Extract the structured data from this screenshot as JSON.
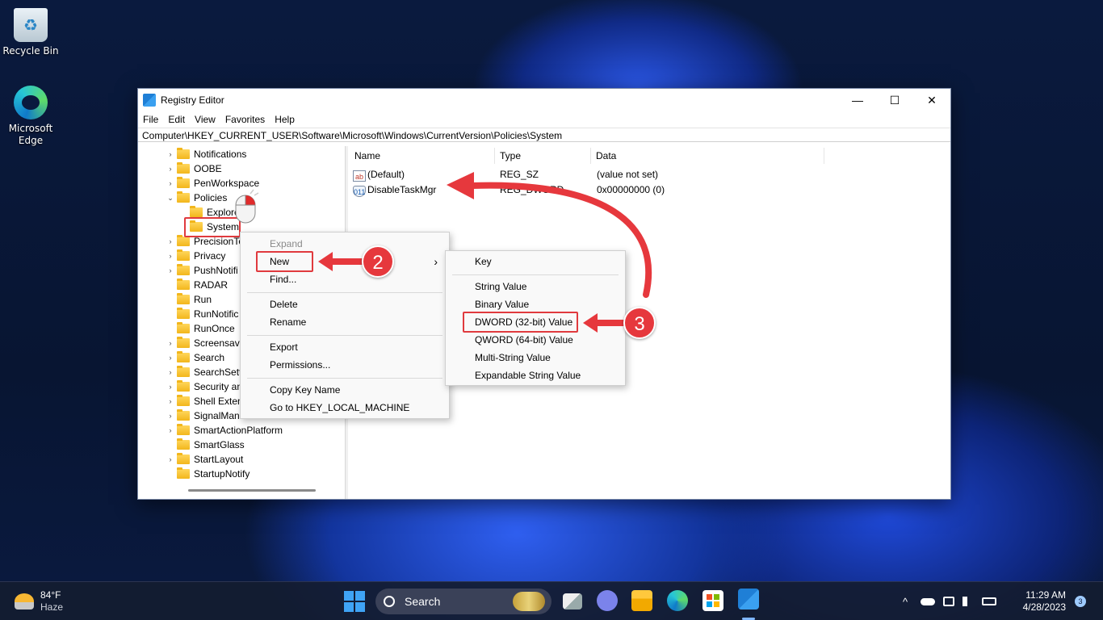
{
  "desktop": {
    "icons": [
      {
        "label": "Recycle Bin",
        "icon": "recycle-bin-icon"
      },
      {
        "label": "Microsoft Edge",
        "icon": "edge-icon"
      }
    ]
  },
  "window": {
    "title": "Registry Editor",
    "controls": {
      "minimize": "—",
      "maximize": "☐",
      "close": "✕"
    },
    "menu": [
      "File",
      "Edit",
      "View",
      "Favorites",
      "Help"
    ],
    "address": "Computer\\HKEY_CURRENT_USER\\Software\\Microsoft\\Windows\\CurrentVersion\\Policies\\System"
  },
  "tree": {
    "items": [
      {
        "label": "Notifications",
        "expander": "›"
      },
      {
        "label": "OOBE",
        "expander": "›"
      },
      {
        "label": "PenWorkspace",
        "expander": "›"
      },
      {
        "label": "Policies",
        "expander": "⌄"
      },
      {
        "label": "Explorer",
        "expander": ""
      },
      {
        "label": "System",
        "expander": ""
      },
      {
        "label": "PrecisionTo",
        "expander": "›"
      },
      {
        "label": "Privacy",
        "expander": "›"
      },
      {
        "label": "PushNotifi",
        "expander": "›"
      },
      {
        "label": "RADAR",
        "expander": ""
      },
      {
        "label": "Run",
        "expander": ""
      },
      {
        "label": "RunNotific",
        "expander": ""
      },
      {
        "label": "RunOnce",
        "expander": ""
      },
      {
        "label": "Screensave",
        "expander": "›"
      },
      {
        "label": "Search",
        "expander": "›"
      },
      {
        "label": "SearchSetti",
        "expander": "›"
      },
      {
        "label": "Security an",
        "expander": "›"
      },
      {
        "label": "Shell Exten",
        "expander": "›"
      },
      {
        "label": "SignalMana",
        "expander": "›"
      },
      {
        "label": "SmartActionPlatform",
        "expander": "›"
      },
      {
        "label": "SmartGlass",
        "expander": ""
      },
      {
        "label": "StartLayout",
        "expander": "›"
      },
      {
        "label": "StartupNotify",
        "expander": ""
      }
    ]
  },
  "values": {
    "columns": [
      "Name",
      "Type",
      "Data"
    ],
    "rows": [
      {
        "icon": "ab",
        "name": "(Default)",
        "type": "REG_SZ",
        "data": "(value not set)"
      },
      {
        "icon": "011",
        "name": "DisableTaskMgr",
        "type": "REG_DWORD",
        "data": "0x00000000 (0)"
      }
    ]
  },
  "context_menu": {
    "expand": "Expand",
    "new": "New",
    "submenu_arrow": "›",
    "find": "Find...",
    "delete": "Delete",
    "rename": "Rename",
    "export": "Export",
    "permissions": "Permissions...",
    "copy_key_name": "Copy Key Name",
    "goto": "Go to HKEY_LOCAL_MACHINE"
  },
  "submenu": {
    "key": "Key",
    "string": "String Value",
    "binary": "Binary Value",
    "dword": "DWORD (32-bit) Value",
    "qword": "QWORD (64-bit) Value",
    "multi": "Multi-String Value",
    "expandable": "Expandable String Value"
  },
  "annotations": {
    "step2": "2",
    "step3": "3",
    "highlight_color": "#e03a3e"
  },
  "taskbar": {
    "weather_temp": "84°F",
    "weather_desc": "Haze",
    "search_label": "Search",
    "tray_chevron": "^",
    "time": "11:29 AM",
    "date": "4/28/2023",
    "notification_count": "3"
  }
}
